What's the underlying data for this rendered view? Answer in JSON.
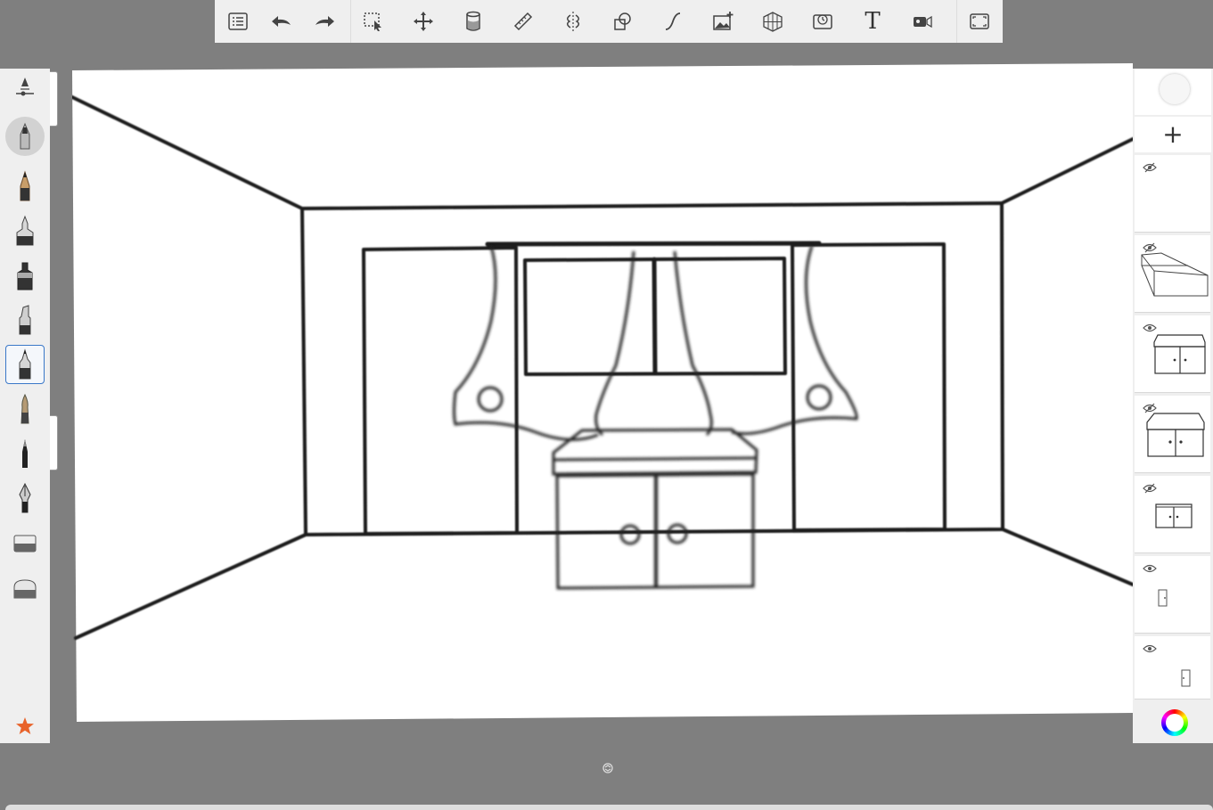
{
  "toolbar": {
    "items": [
      {
        "name": "list-menu-icon",
        "kind": "button"
      },
      {
        "name": "undo-icon",
        "kind": "button"
      },
      {
        "name": "redo-icon",
        "kind": "button"
      },
      {
        "name": "selection-icon",
        "kind": "button"
      },
      {
        "name": "transform-icon",
        "kind": "button"
      },
      {
        "name": "fill-icon",
        "kind": "button"
      },
      {
        "name": "ruler-icon",
        "kind": "button"
      },
      {
        "name": "symmetry-icon",
        "kind": "button"
      },
      {
        "name": "shape-icon",
        "kind": "button"
      },
      {
        "name": "stroke-icon",
        "kind": "button"
      },
      {
        "name": "add-image-icon",
        "kind": "button"
      },
      {
        "name": "perspective-grid-icon",
        "kind": "button"
      },
      {
        "name": "timelapse-icon",
        "kind": "button"
      },
      {
        "name": "text-icon",
        "kind": "button"
      },
      {
        "name": "record-icon",
        "kind": "button"
      },
      {
        "name": "fullscreen-icon",
        "kind": "button"
      }
    ],
    "text_tool_label": "T"
  },
  "brushes": {
    "items": [
      "brush-settings-icon",
      "airbrush-icon",
      "pencil-icon",
      "ballpoint-pen-icon",
      "marker-icon",
      "chisel-marker-icon",
      "fine-liner-icon",
      "paintbrush-icon",
      "ink-pen-icon",
      "fountain-pen-icon",
      "hard-eraser-icon",
      "soft-eraser-icon"
    ],
    "selected": "fine-liner-icon",
    "favorite": "star-icon"
  },
  "layers": {
    "items": [
      {
        "visible": false,
        "content": "empty"
      },
      {
        "visible": false,
        "content": "box-outline"
      },
      {
        "visible": true,
        "content": "cabinet"
      },
      {
        "visible": false,
        "content": "cabinet"
      },
      {
        "visible": false,
        "content": "small-cabinet"
      },
      {
        "visible": true,
        "content": "door-knob"
      },
      {
        "visible": true,
        "content": "door-knob"
      }
    ],
    "add_label": "+"
  },
  "colors": {
    "toolbar_bg": "#efefef",
    "workspace_bg": "#7f7f7f",
    "selection_accent": "#3a78c8",
    "favorite_star": "#e8632a"
  }
}
